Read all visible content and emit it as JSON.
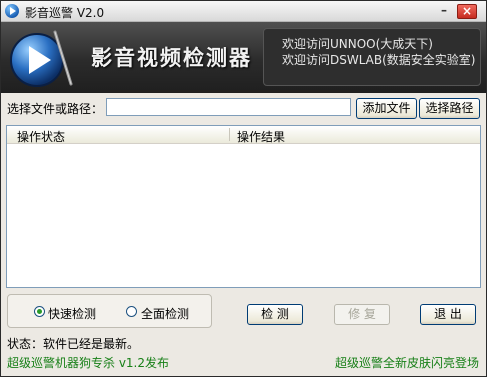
{
  "window": {
    "title": "影音巡警 V2.0",
    "minimize_glyph": "–",
    "close_glyph": "×"
  },
  "banner": {
    "title": "影音视频检测器",
    "info_lines": [
      "欢迎访问UNNOO(大成天下)",
      "欢迎访问DSWLAB(数据安全实验室)"
    ]
  },
  "path_row": {
    "label": "选择文件或路径：",
    "input_value": "",
    "add_file_label": "添加文件",
    "select_path_label": "选择路径"
  },
  "results_table": {
    "columns": [
      "操作状态",
      "操作结果"
    ],
    "rows": []
  },
  "detection_mode": {
    "options": [
      {
        "label": "快速检测",
        "selected": true
      },
      {
        "label": "全面检测",
        "selected": false
      }
    ]
  },
  "actions": {
    "detect_label": "检 测",
    "repair_label": "修 复",
    "exit_label": "退 出"
  },
  "status": {
    "text": "状态：软件已经是最新。"
  },
  "footer": {
    "left_link": "超级巡警机器狗专杀 v1.2发布",
    "right_link": "超级巡警全新皮肤闪亮登场"
  },
  "colors": {
    "link": "#188018",
    "banner_bg": "#2b2b2b",
    "close_button": "#c62c20"
  }
}
